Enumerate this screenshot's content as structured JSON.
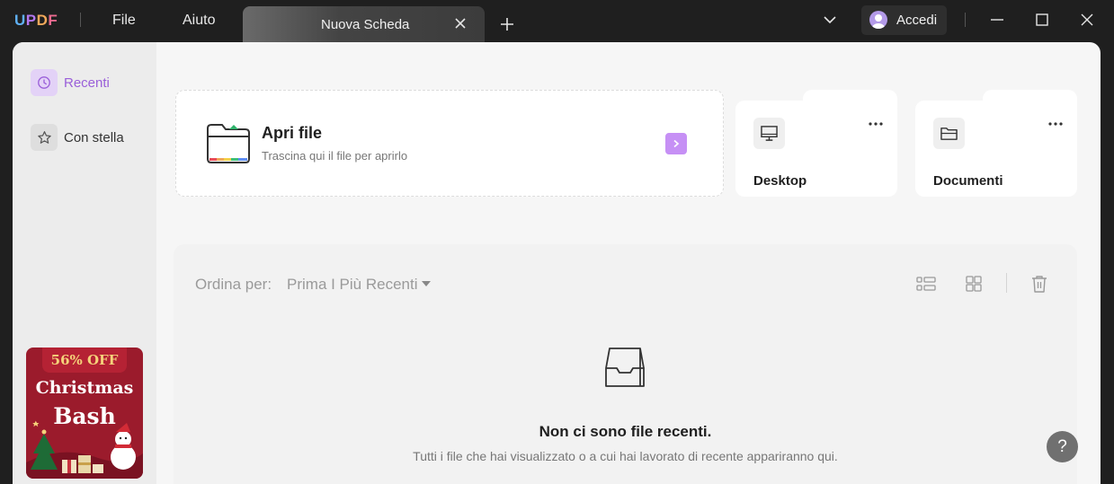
{
  "app": {
    "logo_letters": [
      "U",
      "P",
      "D",
      "F"
    ],
    "logo_colors": [
      "#5fb0f5",
      "#b377f0",
      "#f0a85a",
      "#ea6a8f"
    ]
  },
  "menu": {
    "file": "File",
    "help": "Aiuto"
  },
  "tab": {
    "title": "Nuova Scheda"
  },
  "account": {
    "label": "Accedi"
  },
  "sidebar": {
    "items": [
      {
        "label": "Recenti",
        "icon": "clock-icon",
        "active": true
      },
      {
        "label": "Con stella",
        "icon": "star-icon",
        "active": false
      }
    ],
    "promo": {
      "discount": "56% OFF",
      "line1": "Christmas",
      "line2": "Bash"
    }
  },
  "open_file": {
    "title": "Apri file",
    "subtitle": "Trascina qui il file per aprirlo"
  },
  "folders": [
    {
      "label": "Desktop",
      "icon": "monitor-icon"
    },
    {
      "label": "Documenti",
      "icon": "folder-icon"
    }
  ],
  "recent": {
    "sort_label": "Ordina per:",
    "sort_value": "Prima I Più Recenti",
    "empty_title": "Non ci sono file recenti.",
    "empty_subtitle": "Tutti i file che hai visualizzato o a cui hai lavorato di recente appariranno qui."
  },
  "help": {
    "label": "?"
  },
  "colors": {
    "accent": "#c690f5",
    "accent_dark": "#9a5fd9"
  }
}
